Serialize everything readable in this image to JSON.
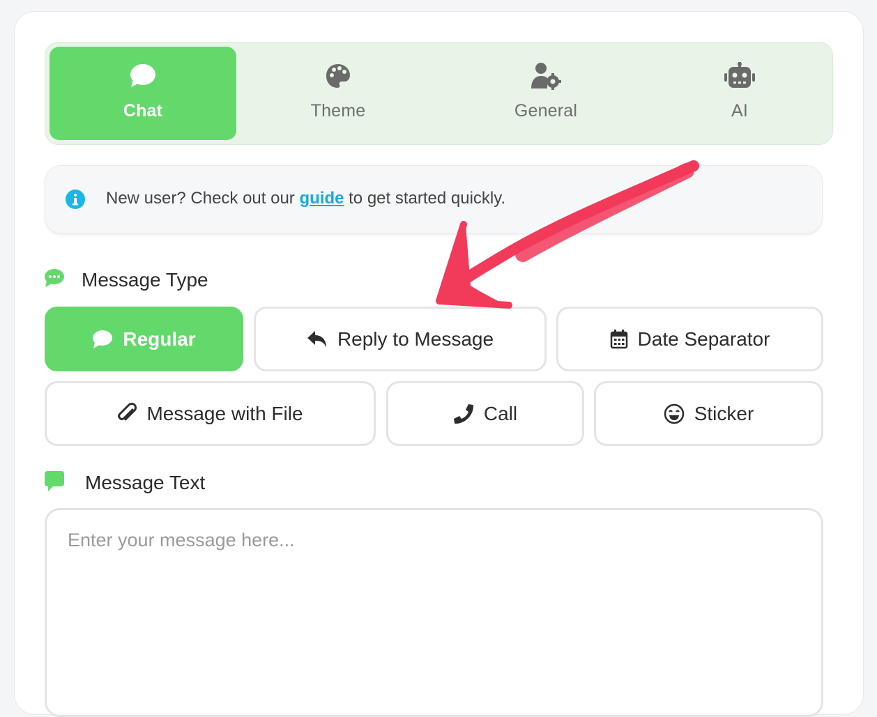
{
  "colors": {
    "accent_green": "#62d96a",
    "tab_bar_bg": "#e8f4e7",
    "link_blue": "#1aa9da",
    "annotation_red": "#f23a5a"
  },
  "tabs": [
    {
      "label": "Chat",
      "icon": "chat-bubble-icon",
      "active": true
    },
    {
      "label": "Theme",
      "icon": "palette-icon",
      "active": false
    },
    {
      "label": "General",
      "icon": "user-gear-icon",
      "active": false
    },
    {
      "label": "AI",
      "icon": "robot-icon",
      "active": false
    }
  ],
  "info": {
    "icon": "info-circle-icon",
    "text_before": "New user? Check out our ",
    "link_text": "guide",
    "text_after": " to get started quickly."
  },
  "message_type": {
    "heading": "Message Type",
    "icon": "chat-dots-icon",
    "options": [
      {
        "label": "Regular",
        "icon": "chat-bubble-icon",
        "active": true
      },
      {
        "label": "Reply to Message",
        "icon": "reply-arrow-icon",
        "active": false
      },
      {
        "label": "Date Separator",
        "icon": "calendar-icon",
        "active": false
      },
      {
        "label": "Message with File",
        "icon": "paperclip-icon",
        "active": false
      },
      {
        "label": "Call",
        "icon": "phone-icon",
        "active": false
      },
      {
        "label": "Sticker",
        "icon": "grin-face-icon",
        "active": false
      }
    ]
  },
  "message_text": {
    "heading": "Message Text",
    "icon": "comment-icon",
    "placeholder": "Enter your message here...",
    "value": ""
  }
}
